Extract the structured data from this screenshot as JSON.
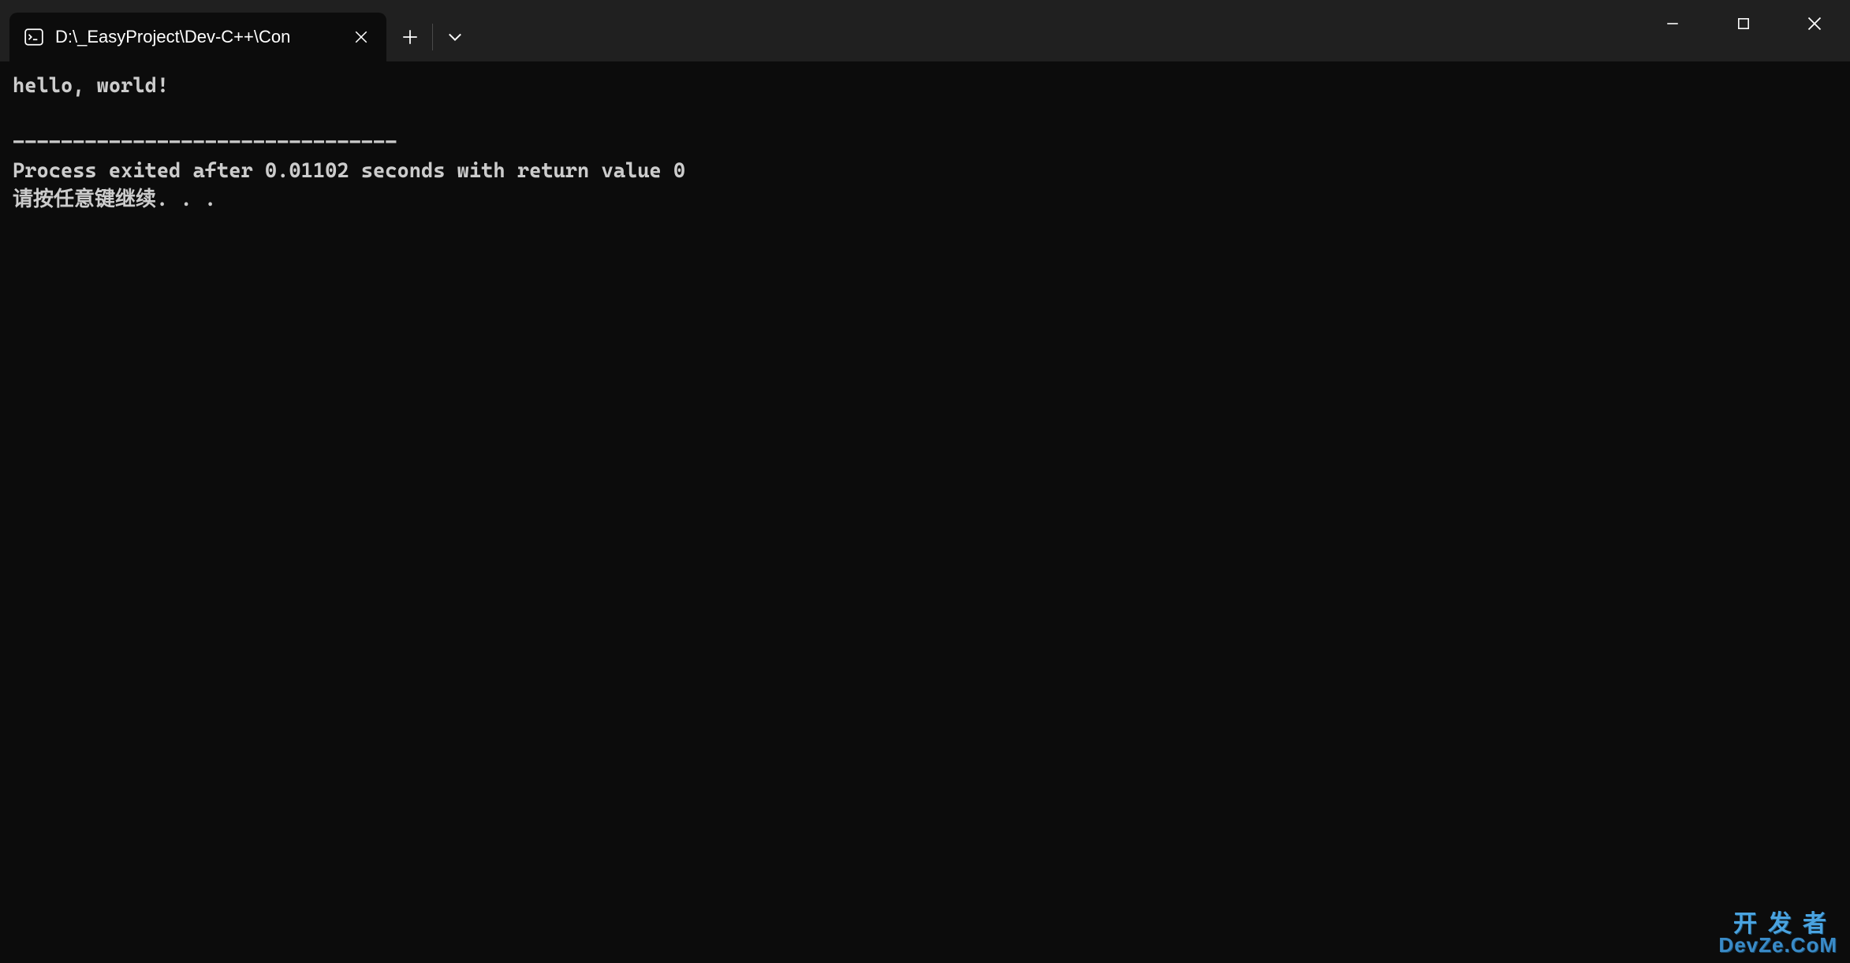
{
  "titlebar": {
    "tab": {
      "title": "D:\\_EasyProject\\Dev-C++\\Con"
    }
  },
  "terminal": {
    "line1": "hello, world!",
    "line2": "",
    "line3": "--------------------------------",
    "line4": "Process exited after 0.01102 seconds with return value 0",
    "line5": "请按任意键继续. . ."
  },
  "watermark": {
    "top": "开发者",
    "bottom": "DevZe.CoM"
  }
}
